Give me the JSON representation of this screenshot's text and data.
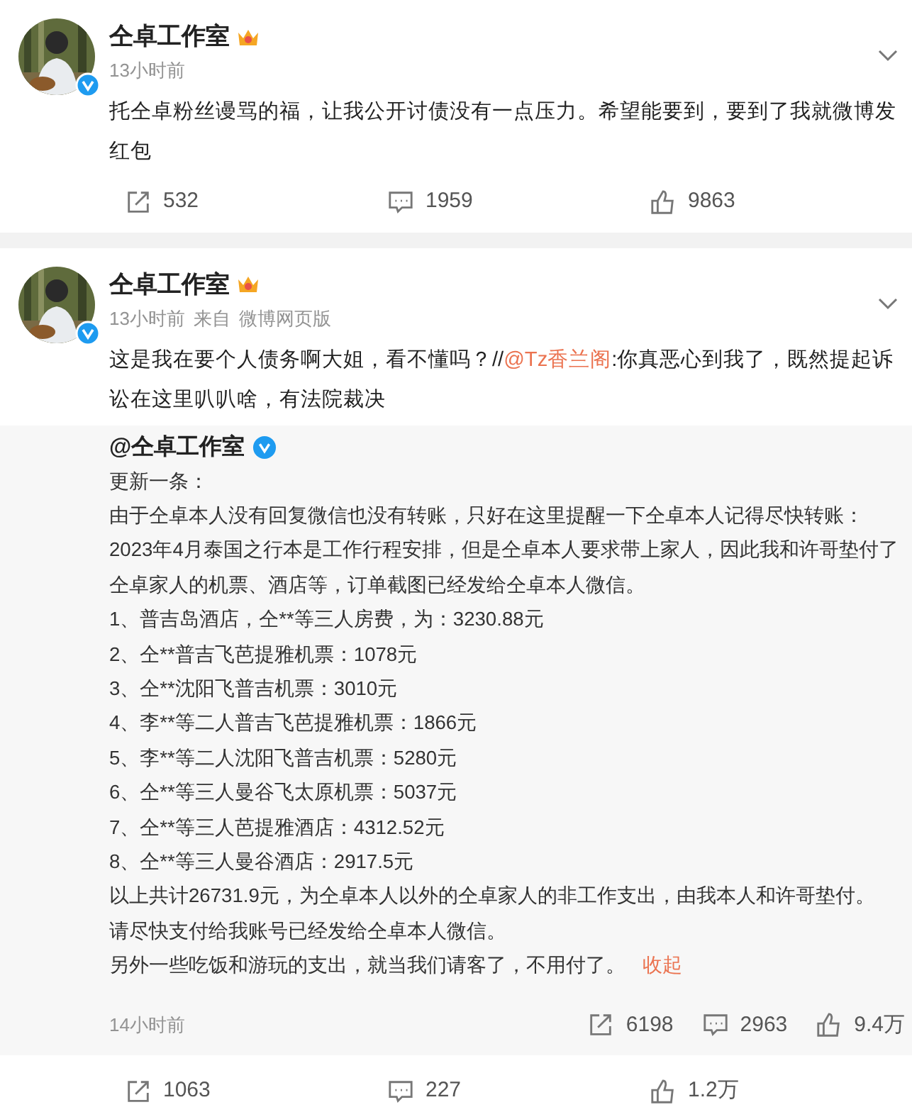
{
  "posts": [
    {
      "author": "仝卓工作室",
      "time": "13小时前",
      "segments": [
        {
          "kind": "text",
          "text": "托仝卓粉丝谩骂的福，让我公开讨债没有一点压力。希望能要到，要到了我就微博发红包"
        }
      ],
      "actions": {
        "reposts": "532",
        "comments": "1959",
        "likes": "9863"
      }
    },
    {
      "author": "仝卓工作室",
      "time": "13小时前",
      "source_label": "来自",
      "source": "微博网页版",
      "segments": [
        {
          "kind": "text",
          "text": "这是我在要个人债务啊大姐，看不懂吗？//"
        },
        {
          "kind": "mention",
          "text": "@Tz香兰阁"
        },
        {
          "kind": "text",
          "text": ":你真恶心到我了，既然提起诉讼在这里叭叭啥，有法院裁决"
        }
      ],
      "quote": {
        "author": "@仝卓工作室",
        "lines": [
          "更新一条：",
          "由于仝卓本人没有回复微信也没有转账，只好在这里提醒一下仝卓本人记得尽快转账：",
          "2023年4月泰国之行本是工作行程安排，但是仝卓本人要求带上家人，因此我和许哥垫付了仝卓家人的机票、酒店等，订单截图已经发给仝卓本人微信。",
          "1、普吉岛酒店，仝**等三人房费，为：3230.88元",
          "2、仝**普吉飞芭提雅机票：1078元",
          "3、仝**沈阳飞普吉机票：3010元",
          "4、李**等二人普吉飞芭提雅机票：1866元",
          "5、李**等二人沈阳飞普吉机票：5280元",
          "6、仝**等三人曼谷飞太原机票：5037元",
          "7、仝**等三人芭提雅酒店：4312.52元",
          "8、仝**等三人曼谷酒店：2917.5元",
          "以上共计26731.9元，为仝卓本人以外的仝卓家人的非工作支出，由我本人和许哥垫付。",
          "请尽快支付给我账号已经发给仝卓本人微信。",
          "另外一些吃饭和游玩的支出，就当我们请客了，不用付了。"
        ],
        "collapse": "收起",
        "time": "14小时前",
        "actions": {
          "reposts": "6198",
          "comments": "2963",
          "likes": "9.4万"
        }
      },
      "actions": {
        "reposts": "1063",
        "comments": "227",
        "likes": "1.2万"
      }
    }
  ]
}
